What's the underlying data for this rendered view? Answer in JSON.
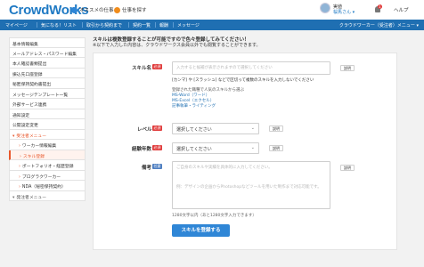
{
  "header": {
    "logo": "CrowdWorks",
    "links": [
      {
        "label": "オススメの仕事",
        "color": "#2f86d6"
      },
      {
        "label": "仕事を探す",
        "color": "#f08c1c"
      }
    ],
    "user": {
      "name": "実値",
      "honorific": "桜馬さん ▾"
    },
    "help": "ヘルプ",
    "notification_count": "1"
  },
  "nav": {
    "items": [
      "マイページ",
      "気になる！リスト",
      "取引から契約まで",
      "契約一覧",
      "報酬",
      "メッセージ"
    ],
    "right": "クラウドワーカー（受注者）メニュー ▾"
  },
  "sidebar": {
    "items": [
      {
        "label": "基本情報編集",
        "type": "normal"
      },
      {
        "label": "メールアドレス・パスワード編集",
        "type": "normal"
      },
      {
        "label": "本人確認書類提出",
        "type": "normal"
      },
      {
        "label": "振込先口座登録",
        "type": "normal"
      },
      {
        "label": "秘匿保持契約書提出",
        "type": "normal"
      },
      {
        "label": "メッセージテンプレート一覧",
        "type": "normal"
      },
      {
        "label": "外部サービス連携",
        "type": "normal"
      },
      {
        "label": "通知設定",
        "type": "normal"
      },
      {
        "label": "公開設定変更",
        "type": "normal"
      },
      {
        "label": "受注者メニュー",
        "type": "group"
      },
      {
        "label": "ワーカー情報編集",
        "type": "sub"
      },
      {
        "label": "スキル登録",
        "type": "active"
      },
      {
        "label": "ポートフォリオ・経歴登録",
        "type": "sub"
      },
      {
        "label": "プログラクワーカー",
        "type": "sub"
      },
      {
        "label": "NDA（秘密保持契約）",
        "type": "sub"
      },
      {
        "label": "発注者メニュー",
        "type": "group"
      }
    ]
  },
  "notice": {
    "title": "スキルは複数登録することが可能ですので色々登録してみてください！",
    "sub": "※以下で入力した内容は、クラウドワークス会員以外でも閲覧することができます。"
  },
  "form": {
    "required_tag": "必須",
    "optional_tag": "任意",
    "skill": {
      "label": "スキル名",
      "placeholder": "入力すると候補が表示されますので選択してください",
      "hint": "[カンマ] や [スラッシュ] などで区切って複数のスキルを入力しないでください",
      "popular_title": "登録された職種で人気のスキルから選ぶ",
      "popular": [
        "MS-Word（ワード）",
        "MS-Excel（エクセル）",
        "記事執筆・ライティング"
      ],
      "small_btn": "説明"
    },
    "level": {
      "label": "レベル",
      "value": "選択してください",
      "small_btn": "説明"
    },
    "experience": {
      "label": "経験年数",
      "value": "選択してください",
      "small_btn": "説明"
    },
    "remarks": {
      "label": "備考",
      "placeholder_line1": "ご自身のスキルや実績を具体的に入力してください。",
      "placeholder_line2": "例：デザインの企画からPhotoshopなどツールを用いた制作まで対応可能です。",
      "counter": "1280文字以内（あと1280文字入力できます）",
      "small_btn": "説明"
    },
    "submit": "スキルを登録する"
  }
}
